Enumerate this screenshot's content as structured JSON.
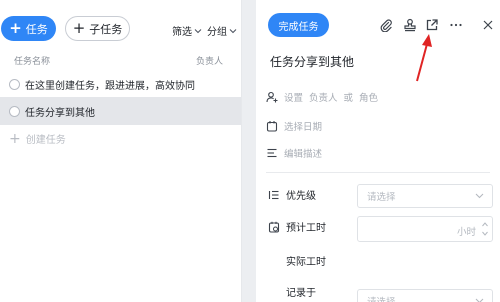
{
  "left": {
    "add_task_label": "任务",
    "add_subtask_label": "子任务",
    "filter_label": "筛选",
    "group_label": "分组",
    "columns": {
      "name": "任务名称",
      "owner": "负责人"
    },
    "tasks": [
      {
        "title": "在这里创建任务，跟进进展，高效协同"
      },
      {
        "title": "任务分享到其他"
      }
    ],
    "create_task_label": "创建任务"
  },
  "detail": {
    "complete_button": "完成任务",
    "title": "任务分享到其他",
    "owner_prompt": "设置",
    "owner_link": "负责人",
    "owner_or": "或",
    "owner_role": "角色",
    "date_prompt": "选择日期",
    "desc_prompt": "编辑描述",
    "priority_label": "优先级",
    "priority_placeholder": "请选择",
    "estimate_label": "预计工时",
    "hours_unit": "小时",
    "actual_label": "实际工时",
    "record_label": "记录于",
    "record_placeholder": "请选择"
  },
  "icons": {
    "attach": "paperclip-icon",
    "assign": "stamp-icon",
    "share": "external-share-icon",
    "more": "more-icon",
    "close": "close-icon"
  },
  "colors": {
    "accent": "#2f86f6",
    "annotation_arrow": "#e02424",
    "selected_row": "#e4e6ea"
  }
}
